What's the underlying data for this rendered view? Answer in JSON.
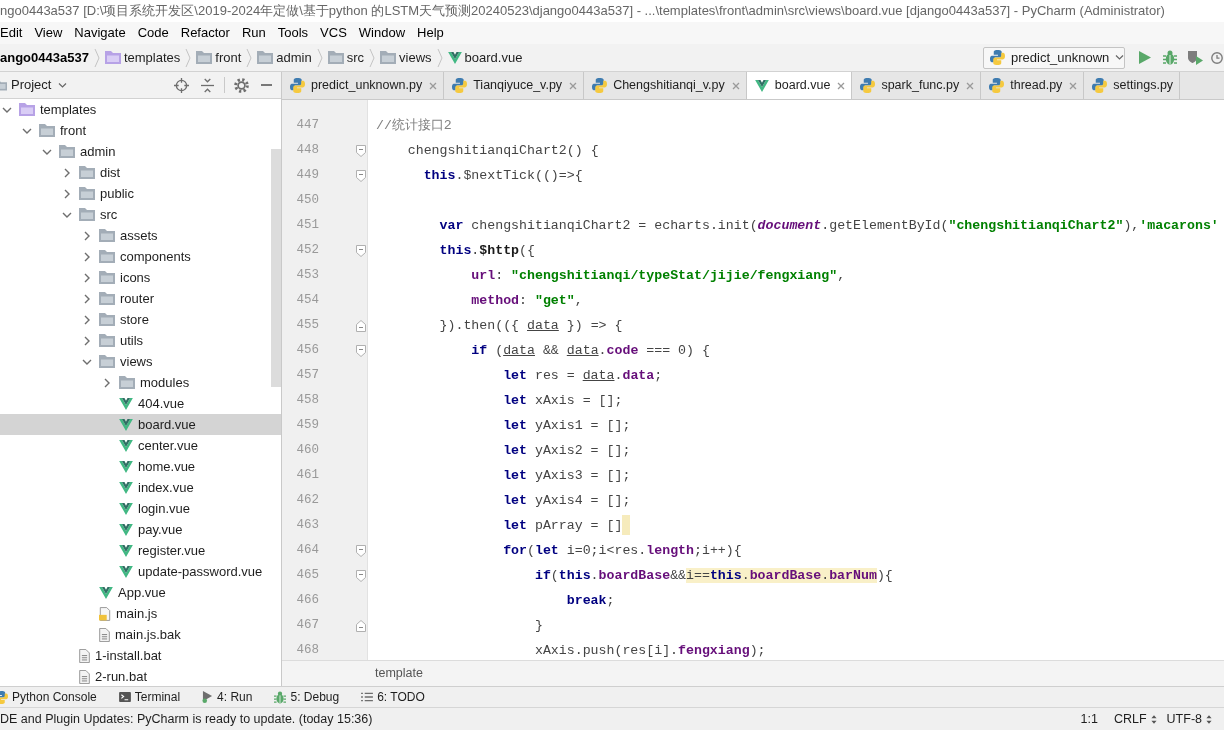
{
  "window": {
    "title": "ngo0443a537 [D:\\项目系统开发区\\2019-2024年定做\\基于python 的LSTM天气预测20240523\\django0443a537] - ...\\templates\\front\\admin\\src\\views\\board.vue [django0443a537] - PyCharm (Administrator)"
  },
  "menu": [
    "Edit",
    "View",
    "Navigate",
    "Code",
    "Refactor",
    "Run",
    "Tools",
    "VCS",
    "Window",
    "Help"
  ],
  "navigation_bar": {
    "crumbs": [
      {
        "label": "ango0443a537",
        "kind": "project"
      },
      {
        "label": "templates",
        "kind": "template_folder"
      },
      {
        "label": "front",
        "kind": "folder"
      },
      {
        "label": "admin",
        "kind": "folder"
      },
      {
        "label": "src",
        "kind": "folder"
      },
      {
        "label": "views",
        "kind": "folder"
      },
      {
        "label": "board.vue",
        "kind": "vue"
      }
    ],
    "run_config": "predict_unknown"
  },
  "project_panel": {
    "title": "Project",
    "tree": [
      {
        "label": "templates",
        "kind": "template_folder",
        "expanded": true,
        "selected": false,
        "children": [
          {
            "label": "front",
            "kind": "folder",
            "expanded": true,
            "selected": false,
            "children": [
              {
                "label": "admin",
                "kind": "folder",
                "expanded": true,
                "selected": false,
                "children": [
                  {
                    "label": "dist",
                    "kind": "folder",
                    "expanded": false,
                    "selected": false
                  },
                  {
                    "label": "public",
                    "kind": "folder",
                    "expanded": false,
                    "selected": false
                  },
                  {
                    "label": "src",
                    "kind": "folder",
                    "expanded": true,
                    "selected": false,
                    "children": [
                      {
                        "label": "assets",
                        "kind": "folder",
                        "expanded": false,
                        "selected": false
                      },
                      {
                        "label": "components",
                        "kind": "folder",
                        "expanded": false,
                        "selected": false
                      },
                      {
                        "label": "icons",
                        "kind": "folder",
                        "expanded": false,
                        "selected": false
                      },
                      {
                        "label": "router",
                        "kind": "folder",
                        "expanded": false,
                        "selected": false
                      },
                      {
                        "label": "store",
                        "kind": "folder",
                        "expanded": false,
                        "selected": false
                      },
                      {
                        "label": "utils",
                        "kind": "folder",
                        "expanded": false,
                        "selected": false
                      },
                      {
                        "label": "views",
                        "kind": "folder",
                        "expanded": true,
                        "selected": false,
                        "children": [
                          {
                            "label": "modules",
                            "kind": "folder",
                            "expanded": false,
                            "selected": false
                          },
                          {
                            "label": "404.vue",
                            "kind": "vue",
                            "selected": false
                          },
                          {
                            "label": "board.vue",
                            "kind": "vue",
                            "selected": true
                          },
                          {
                            "label": "center.vue",
                            "kind": "vue",
                            "selected": false
                          },
                          {
                            "label": "home.vue",
                            "kind": "vue",
                            "selected": false
                          },
                          {
                            "label": "index.vue",
                            "kind": "vue",
                            "selected": false
                          },
                          {
                            "label": "login.vue",
                            "kind": "vue",
                            "selected": false
                          },
                          {
                            "label": "pay.vue",
                            "kind": "vue",
                            "selected": false
                          },
                          {
                            "label": "register.vue",
                            "kind": "vue",
                            "selected": false
                          },
                          {
                            "label": "update-password.vue",
                            "kind": "vue",
                            "selected": false
                          }
                        ]
                      },
                      {
                        "label": "App.vue",
                        "kind": "vue",
                        "selected": false
                      },
                      {
                        "label": "main.js",
                        "kind": "js",
                        "selected": false
                      },
                      {
                        "label": "main.js.bak",
                        "kind": "text",
                        "selected": false
                      }
                    ]
                  },
                  {
                    "label": "1-install.bat",
                    "kind": "text",
                    "selected": false
                  },
                  {
                    "label": "2-run.bat",
                    "kind": "text",
                    "selected": false
                  }
                ]
              }
            ]
          }
        ]
      }
    ]
  },
  "editor": {
    "tabs": [
      {
        "label": "predict_unknown.py",
        "kind": "python",
        "selected": false,
        "closable": true
      },
      {
        "label": "Tianqiyuce_v.py",
        "kind": "python",
        "selected": false,
        "closable": true
      },
      {
        "label": "Chengshitianqi_v.py",
        "kind": "python",
        "selected": false,
        "closable": true
      },
      {
        "label": "board.vue",
        "kind": "vue",
        "selected": true,
        "closable": true
      },
      {
        "label": "spark_func.py",
        "kind": "python",
        "selected": false,
        "closable": true
      },
      {
        "label": "thread.py",
        "kind": "python",
        "selected": false,
        "closable": true
      },
      {
        "label": "settings.py",
        "kind": "python",
        "selected": false,
        "closable": false
      }
    ],
    "lines": [
      {
        "number": "447",
        "segments": [
          {
            "text": " //统计接口2",
            "kind": "comment"
          }
        ]
      },
      {
        "number": "448",
        "fold": {
          "kind": "start"
        },
        "segments": [
          {
            "text": "     chengshitianqiChart2() {",
            "kind": "plain"
          }
        ]
      },
      {
        "number": "449",
        "fold": {
          "kind": "start"
        },
        "segments": [
          {
            "text": "       this",
            "kind": "keyword"
          },
          {
            "text": ".$nextTick(()=>{",
            "kind": "plain"
          }
        ]
      },
      {
        "number": "450"
      },
      {
        "number": "451",
        "segments": [
          {
            "text": "         var",
            "kind": "keyword"
          },
          {
            "text": " chengshitianqiChart2 = echarts.init(",
            "kind": "plain"
          },
          {
            "text": "document",
            "kind": "global"
          },
          {
            "text": ".getElementById(",
            "kind": "plain"
          },
          {
            "text": "\"chengshitianqiChart2\"",
            "kind": "string"
          },
          {
            "text": "),",
            "kind": "plain"
          },
          {
            "text": "'macarons'",
            "kind": "string"
          }
        ]
      },
      {
        "number": "452",
        "fold": {
          "kind": "start"
        },
        "segments": [
          {
            "text": "         this",
            "kind": "keyword"
          },
          {
            "text": ".",
            "kind": "plain"
          },
          {
            "text": "$http",
            "kind": "bold"
          },
          {
            "text": "({",
            "kind": "plain"
          }
        ]
      },
      {
        "number": "453",
        "segments": [
          {
            "text": "             url",
            "kind": "field"
          },
          {
            "text": ": ",
            "kind": "plain"
          },
          {
            "text": "\"chengshitianqi/typeStat/jijie/fengxiang\"",
            "kind": "string"
          },
          {
            "text": ",",
            "kind": "plain"
          }
        ]
      },
      {
        "number": "454",
        "segments": [
          {
            "text": "             method",
            "kind": "field"
          },
          {
            "text": ": ",
            "kind": "plain"
          },
          {
            "text": "\"get\"",
            "kind": "string"
          },
          {
            "text": ",",
            "kind": "plain"
          }
        ]
      },
      {
        "number": "455",
        "fold": {
          "kind": "end"
        },
        "segments": [
          {
            "text": "         }).then(({ ",
            "kind": "plain"
          },
          {
            "text": "data",
            "kind": "param"
          },
          {
            "text": " }) => {",
            "kind": "plain"
          }
        ]
      },
      {
        "number": "456",
        "fold": {
          "kind": "start"
        },
        "segments": [
          {
            "text": "             if",
            "kind": "keyword"
          },
          {
            "text": " (",
            "kind": "plain"
          },
          {
            "text": "data",
            "kind": "param"
          },
          {
            "text": " && ",
            "kind": "plain"
          },
          {
            "text": "data",
            "kind": "param"
          },
          {
            "text": ".",
            "kind": "plain"
          },
          {
            "text": "code",
            "kind": "field"
          },
          {
            "text": " === 0) {",
            "kind": "plain"
          }
        ]
      },
      {
        "number": "457",
        "segments": [
          {
            "text": "                 let",
            "kind": "keyword"
          },
          {
            "text": " res = ",
            "kind": "plain"
          },
          {
            "text": "data",
            "kind": "param"
          },
          {
            "text": ".",
            "kind": "plain"
          },
          {
            "text": "data",
            "kind": "field"
          },
          {
            "text": ";",
            "kind": "plain"
          }
        ]
      },
      {
        "number": "458",
        "segments": [
          {
            "text": "                 let",
            "kind": "keyword"
          },
          {
            "text": " xAxis = [];",
            "kind": "plain"
          }
        ]
      },
      {
        "number": "459",
        "segments": [
          {
            "text": "                 let",
            "kind": "keyword"
          },
          {
            "text": " yAxis1 = [];",
            "kind": "plain"
          }
        ]
      },
      {
        "number": "460",
        "segments": [
          {
            "text": "                 let",
            "kind": "keyword"
          },
          {
            "text": " yAxis2 = [];",
            "kind": "plain"
          }
        ]
      },
      {
        "number": "461",
        "segments": [
          {
            "text": "                 let",
            "kind": "keyword"
          },
          {
            "text": " yAxis3 = [];",
            "kind": "plain"
          }
        ]
      },
      {
        "number": "462",
        "segments": [
          {
            "text": "                 let",
            "kind": "keyword"
          },
          {
            "text": " yAxis4 = [];",
            "kind": "plain"
          }
        ]
      },
      {
        "number": "463",
        "segments": [
          {
            "text": "                 let",
            "kind": "keyword"
          },
          {
            "text": " pArray = []",
            "kind": "plain"
          },
          {
            "kind": "warning_mark"
          }
        ]
      },
      {
        "number": "464",
        "fold": {
          "kind": "start"
        },
        "segments": [
          {
            "text": "                 for",
            "kind": "keyword"
          },
          {
            "text": "(",
            "kind": "plain"
          },
          {
            "text": "let",
            "kind": "keyword"
          },
          {
            "text": " i=0;i<res.",
            "kind": "plain"
          },
          {
            "text": "length",
            "kind": "field"
          },
          {
            "text": ";i++){",
            "kind": "plain"
          }
        ]
      },
      {
        "number": "465",
        "fold": {
          "kind": "start"
        },
        "segments": [
          {
            "text": "                     if",
            "kind": "keyword"
          },
          {
            "text": "(",
            "kind": "plain"
          },
          {
            "text": "this",
            "kind": "keyword"
          },
          {
            "text": ".",
            "kind": "plain"
          },
          {
            "text": "boardBase",
            "kind": "field"
          },
          {
            "text": "&&",
            "kind": "plain"
          },
          {
            "kind": "highlight",
            "segments": [
              {
                "text": "i==",
                "kind": "plain"
              },
              {
                "text": "this",
                "kind": "keyword"
              },
              {
                "text": ".",
                "kind": "plain"
              },
              {
                "text": "boardBase",
                "kind": "field"
              },
              {
                "text": ".",
                "kind": "plain"
              },
              {
                "text": "barNum",
                "kind": "field"
              }
            ]
          },
          {
            "text": "){",
            "kind": "plain"
          }
        ]
      },
      {
        "number": "466",
        "segments": [
          {
            "text": "                         break",
            "kind": "keyword"
          },
          {
            "text": ";",
            "kind": "plain"
          }
        ]
      },
      {
        "number": "467",
        "fold": {
          "kind": "end"
        },
        "segments": [
          {
            "text": "                     }",
            "kind": "plain"
          }
        ]
      },
      {
        "number": "468",
        "segments": [
          {
            "text": "                     xAxis.push(res[i].",
            "kind": "plain"
          },
          {
            "text": "fengxiang",
            "kind": "field"
          },
          {
            "text": ");",
            "kind": "plain"
          }
        ]
      }
    ],
    "breadcrumb": "template"
  },
  "tool_windows": [
    {
      "label": "Python Console",
      "kind": "console"
    },
    {
      "label": "Terminal",
      "kind": "terminal"
    },
    {
      "label": "4: Run",
      "kind": "run"
    },
    {
      "label": "5: Debug",
      "kind": "debug"
    },
    {
      "label": "6: TODO",
      "kind": "todo"
    }
  ],
  "status_bar": {
    "message": "DE and Plugin Updates: PyCharm is ready to update. (today 15:36)",
    "position": "1:1",
    "line_separator": "CRLF",
    "encoding": "UTF-8"
  }
}
